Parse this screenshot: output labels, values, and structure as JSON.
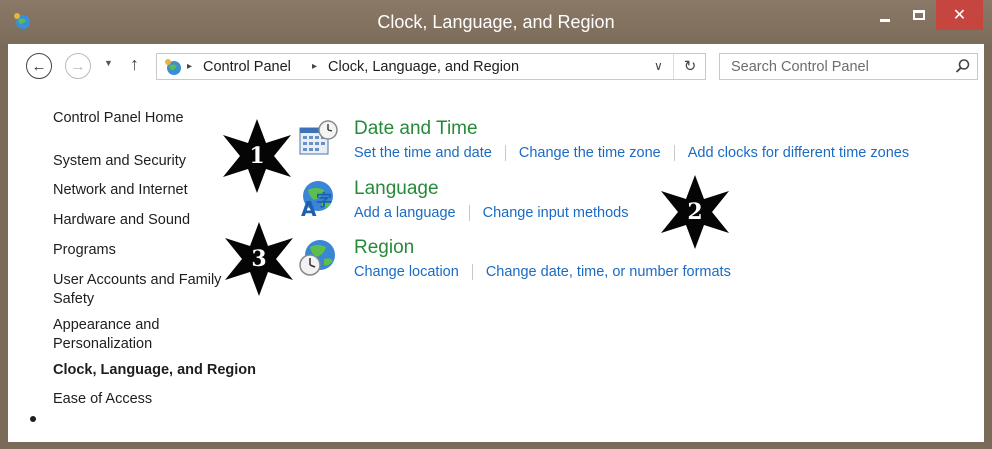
{
  "window": {
    "title": "Clock, Language, and Region",
    "close_glyph": "✕"
  },
  "address": {
    "crumbs": [
      "Control Panel",
      "Clock, Language, and Region"
    ],
    "separator": "▸",
    "search_placeholder": "Search Control Panel"
  },
  "nav": {
    "back": "←",
    "forward": "→",
    "recent": "▼",
    "up": "↑",
    "dropdown": "∨",
    "refresh": "↻"
  },
  "sidebar": {
    "home": "Control Panel Home",
    "items": [
      "System and Security",
      "Network and Internet",
      "Hardware and Sound",
      "Programs",
      "User Accounts and Family Safety",
      "Appearance and Personalization",
      "Clock, Language, and Region",
      "Ease of Access"
    ]
  },
  "categories": [
    {
      "title": "Date and Time",
      "icon": "calendar-clock-icon",
      "links": [
        "Set the time and date",
        "Change the time zone",
        "Add clocks for different time zones"
      ]
    },
    {
      "title": "Language",
      "icon": "language-globe-icon",
      "links": [
        "Add a language",
        "Change input methods"
      ]
    },
    {
      "title": "Region",
      "icon": "region-globe-clock-icon",
      "links": [
        "Change location",
        "Change date, time, or number formats"
      ]
    }
  ],
  "annotations": [
    "1",
    "2",
    "3"
  ],
  "colors": {
    "category_title": "#268a3a",
    "link": "#1a6bc4",
    "close_button": "#c7453f",
    "titlebar": "#7c6c5a"
  }
}
